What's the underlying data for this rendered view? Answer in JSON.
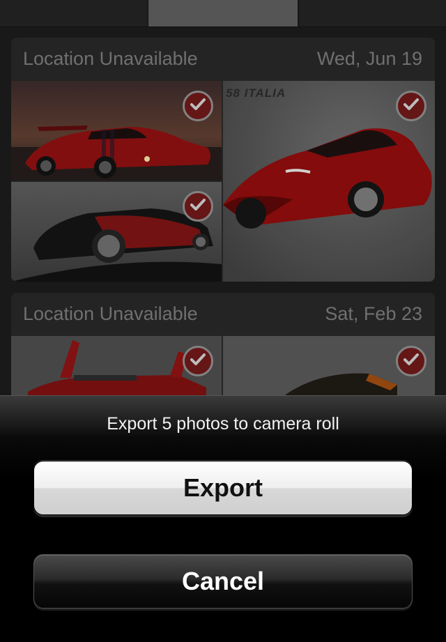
{
  "feed": {
    "cards": [
      {
        "location": "Location Unavailable",
        "date": "Wed, Jun 19",
        "photos": [
          {
            "name": "red-viper-photo",
            "selected": true
          },
          {
            "name": "black-red-concept-car-photo",
            "selected": true
          },
          {
            "name": "red-ferrari-458-italia-photo",
            "selected": true,
            "caption": "58 ITALIA"
          }
        ]
      },
      {
        "location": "Location Unavailable",
        "date": "Sat, Feb 23",
        "photos": [
          {
            "name": "red-open-supercar-photo",
            "selected": true
          },
          {
            "name": "dark-supercar-photo",
            "selected": true
          }
        ]
      }
    ]
  },
  "action_sheet": {
    "title": "Export 5 photos to camera roll",
    "export_label": "Export",
    "cancel_label": "Cancel"
  },
  "colors": {
    "check_badge": "#6b1818",
    "car_red": "#c41414",
    "sheet_bg": "#000000"
  },
  "icons": [
    "checkmark-icon"
  ]
}
